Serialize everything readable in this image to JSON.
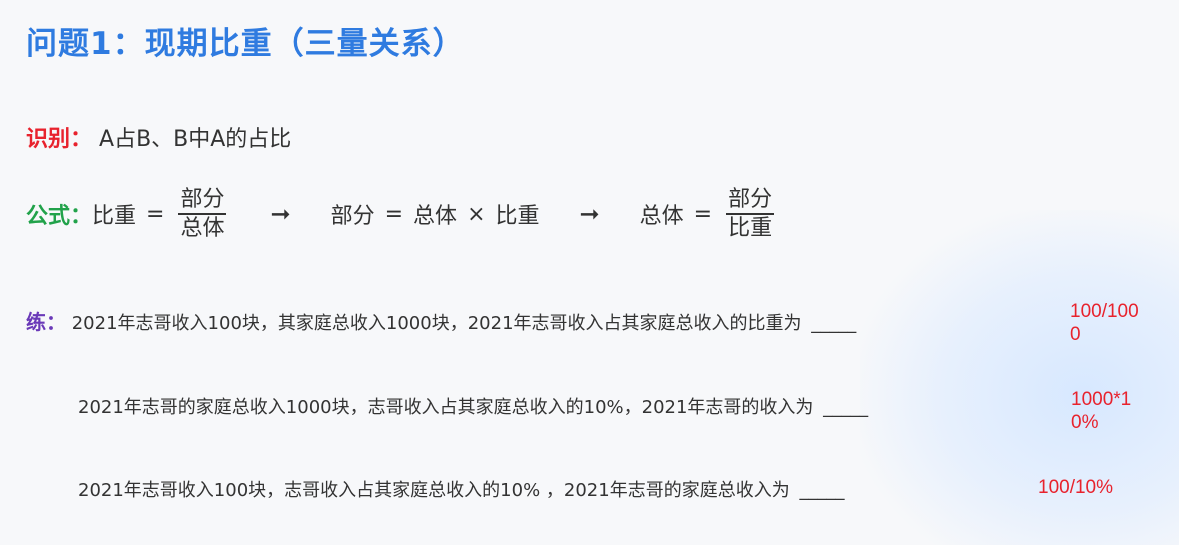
{
  "title": "问题1：现期比重（三量关系）",
  "identify": {
    "label": "识别：",
    "text": "A占B、B中A的占比"
  },
  "formula": {
    "label": "公式：",
    "f1": {
      "left": "比重",
      "eq": "=",
      "num": "部分",
      "den": "总体"
    },
    "arrow1": "➞",
    "f2": {
      "left": "部分",
      "eq": "=",
      "a": "总体",
      "times": "×",
      "b": "比重"
    },
    "arrow2": "➞",
    "f3": {
      "left": "总体",
      "eq": "=",
      "num": "部分",
      "den": "比重"
    }
  },
  "practice": {
    "label": "练：",
    "q1": {
      "text": "2021年志哥收入100块，其家庭总收入1000块，2021年志哥收入占其家庭总收入的比重为",
      "blank": "_____",
      "answer_line1": "100/100",
      "answer_line2": "0"
    },
    "q2": {
      "text": "2021年志哥的家庭总收入1000块，志哥收入占其家庭总收入的10%，2021年志哥的收入为",
      "blank": "_____",
      "answer_line1": "1000*1",
      "answer_line2": "0%"
    },
    "q3": {
      "text": "2021年志哥收入100块，志哥收入占其家庭总收入的10% ，2021年志哥的家庭总收入为",
      "blank": "_____",
      "answer": "100/10%"
    }
  }
}
